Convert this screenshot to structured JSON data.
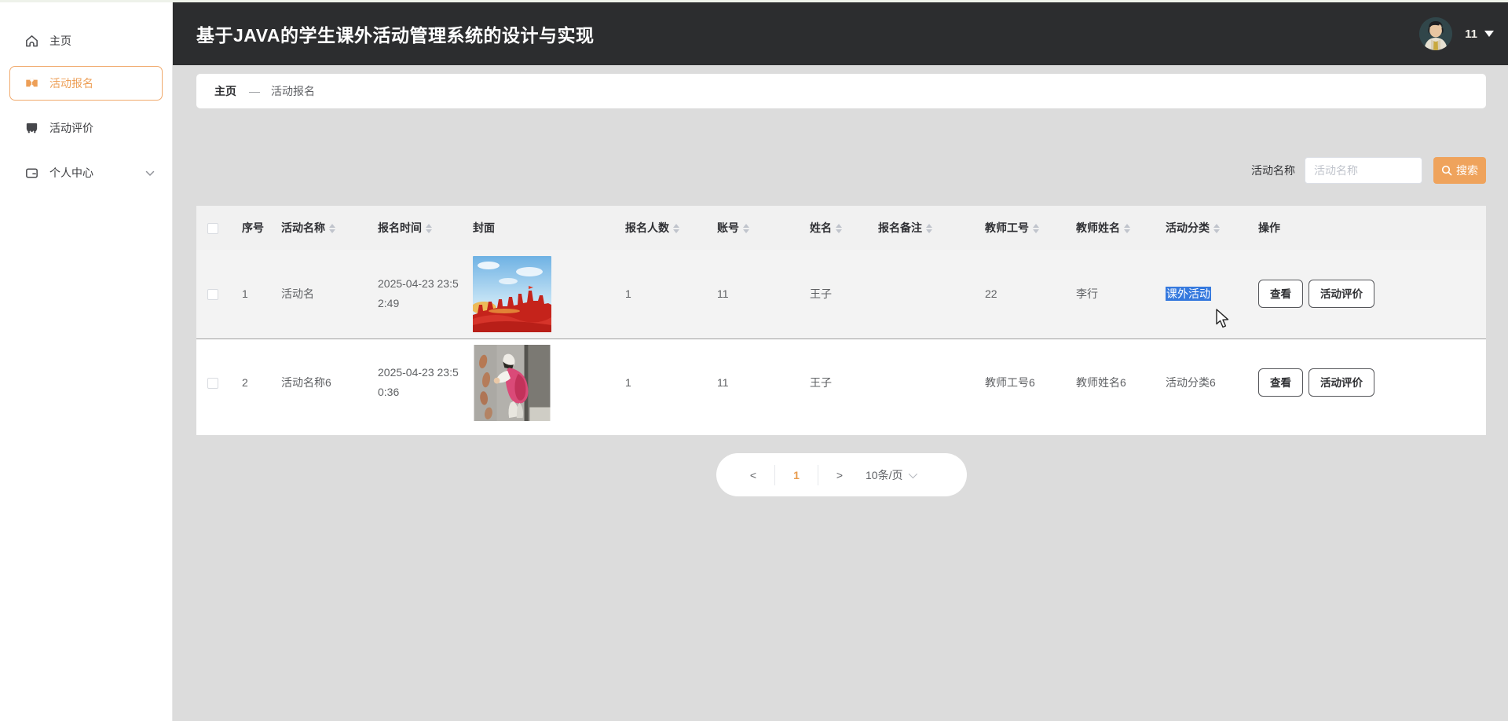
{
  "app": {
    "title": "基于JAVA的学生课外活动管理系统的设计与实现"
  },
  "user": {
    "display": "11"
  },
  "sidebar": {
    "items": [
      {
        "label": "主页",
        "icon": "home-icon",
        "active": false
      },
      {
        "label": "活动报名",
        "icon": "ticket-icon",
        "active": true
      },
      {
        "label": "活动评价",
        "icon": "shop-icon",
        "active": false
      },
      {
        "label": "个人中心",
        "icon": "card-icon",
        "active": false,
        "expandable": true
      }
    ]
  },
  "breadcrumb": {
    "home": "主页",
    "separator": "—",
    "current": "活动报名"
  },
  "search": {
    "label": "活动名称",
    "placeholder": "活动名称",
    "button": "搜索"
  },
  "table": {
    "columns": [
      {
        "label": "",
        "key": "select"
      },
      {
        "label": "序号",
        "key": "index",
        "sortable": false
      },
      {
        "label": "活动名称",
        "key": "activity_name",
        "sortable": true
      },
      {
        "label": "报名时间",
        "key": "signup_time",
        "sortable": true
      },
      {
        "label": "封面",
        "key": "cover",
        "sortable": false
      },
      {
        "label": "报名人数",
        "key": "signup_count",
        "sortable": true
      },
      {
        "label": "账号",
        "key": "account",
        "sortable": true
      },
      {
        "label": "姓名",
        "key": "name",
        "sortable": true
      },
      {
        "label": "报名备注",
        "key": "remark",
        "sortable": true
      },
      {
        "label": "教师工号",
        "key": "teacher_id",
        "sortable": true
      },
      {
        "label": "教师姓名",
        "key": "teacher_name",
        "sortable": true
      },
      {
        "label": "活动分类",
        "key": "category",
        "sortable": true
      },
      {
        "label": "操作",
        "key": "actions",
        "sortable": false
      }
    ],
    "actions": {
      "view": "查看",
      "evaluate": "活动评价"
    },
    "rows": [
      {
        "index": "1",
        "activity_name": "活动名",
        "signup_time": "2025-04-23 23:52:49",
        "cover_desc": "红色城市天际线宣传海报",
        "signup_count": "1",
        "account": "11",
        "name": "王子",
        "remark": "",
        "teacher_id": "22",
        "teacher_name": "李行",
        "category": "课外活动",
        "category_text_selected": true,
        "hovered": true
      },
      {
        "index": "2",
        "activity_name": "活动名称6",
        "signup_time": "2025-04-23 23:50:36",
        "cover_desc": "志愿者墙边劳动照片",
        "signup_count": "1",
        "account": "11",
        "name": "王子",
        "remark": "",
        "teacher_id": "教师工号6",
        "teacher_name": "教师姓名6",
        "category": "活动分类6",
        "category_text_selected": false,
        "hovered": false
      }
    ]
  },
  "pagination": {
    "prev": "<",
    "page": "1",
    "next": ">",
    "page_size": "10条/页"
  },
  "colors": {
    "accent": "#ed9f57",
    "appbar_bg": "#2c2d2f",
    "page_bg": "#dcdcdc",
    "selection_blue": "#3579de",
    "row_hover": "#f3f3f3",
    "table_header_bg": "#f1f1f1"
  }
}
